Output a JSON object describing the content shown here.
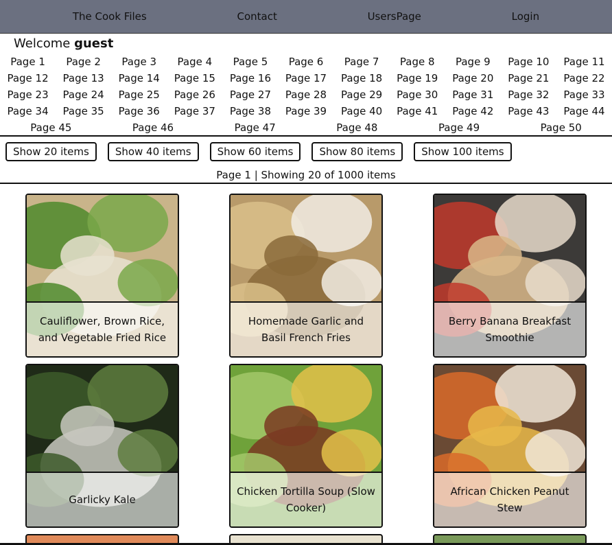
{
  "nav": {
    "brand": "The Cook Files",
    "contact": "Contact",
    "users": "UsersPage",
    "login": "Login"
  },
  "welcome": {
    "prefix": "Welcome",
    "user": "guest"
  },
  "pages": {
    "rows": [
      [
        "Page 1",
        "Page 2",
        "Page 3",
        "Page 4",
        "Page 5",
        "Page 6",
        "Page 7",
        "Page 8",
        "Page 9",
        "Page 10",
        "Page 11"
      ],
      [
        "Page 12",
        "Page 13",
        "Page 14",
        "Page 15",
        "Page 16",
        "Page 17",
        "Page 18",
        "Page 19",
        "Page 20",
        "Page 21",
        "Page 22"
      ],
      [
        "Page 23",
        "Page 24",
        "Page 25",
        "Page 26",
        "Page 27",
        "Page 28",
        "Page 29",
        "Page 30",
        "Page 31",
        "Page 32",
        "Page 33"
      ],
      [
        "Page 34",
        "Page 35",
        "Page 36",
        "Page 37",
        "Page 38",
        "Page 39",
        "Page 40",
        "Page 41",
        "Page 42",
        "Page 43",
        "Page 44"
      ],
      [
        "Page 45",
        "Page 46",
        "Page 47",
        "Page 48",
        "Page 49",
        "Page 50"
      ]
    ]
  },
  "show_buttons": [
    "Show 20 items",
    "Show 40 items",
    "Show 60 items",
    "Show 80 items",
    "Show 100 items"
  ],
  "status": "Page 1 | Showing 20 of 1000 items",
  "recipes": [
    {
      "title": "Cauliflower, Brown Rice, and Vegetable Fried Rice",
      "image": "fried-rice-photo",
      "colors": [
        "#c9b48a",
        "#4f8a2c",
        "#7aa84a",
        "#e8e2d0"
      ]
    },
    {
      "title": "Homemade Garlic and Basil French Fries",
      "image": "french-fries-photo",
      "colors": [
        "#b89a6a",
        "#d9c08a",
        "#f1ece4",
        "#8a6a3a"
      ]
    },
    {
      "title": "Berry Banana Breakfast Smoothie",
      "image": "smoothie-photo",
      "colors": [
        "#3c3a38",
        "#c0392b",
        "#e7dccb",
        "#d9b98a"
      ]
    },
    {
      "title": "Garlicky Kale",
      "image": "kale-photo",
      "colors": [
        "#1f2a18",
        "#3d5a2a",
        "#5e7d3e",
        "#c8c8c0"
      ]
    },
    {
      "title": "Chicken Tortilla Soup (Slow Cooker)",
      "image": "tortilla-soup-photo",
      "colors": [
        "#6fa23a",
        "#a3c86a",
        "#e3c14a",
        "#7a3a22"
      ]
    },
    {
      "title": "African Chicken Peanut Stew",
      "image": "peanut-stew-photo",
      "colors": [
        "#6a4a34",
        "#d86a2a",
        "#f0e6d8",
        "#e8b84a"
      ]
    }
  ],
  "partial_colors": [
    "#e08a5a",
    "#e8e2d0",
    "#7a9a5a"
  ]
}
